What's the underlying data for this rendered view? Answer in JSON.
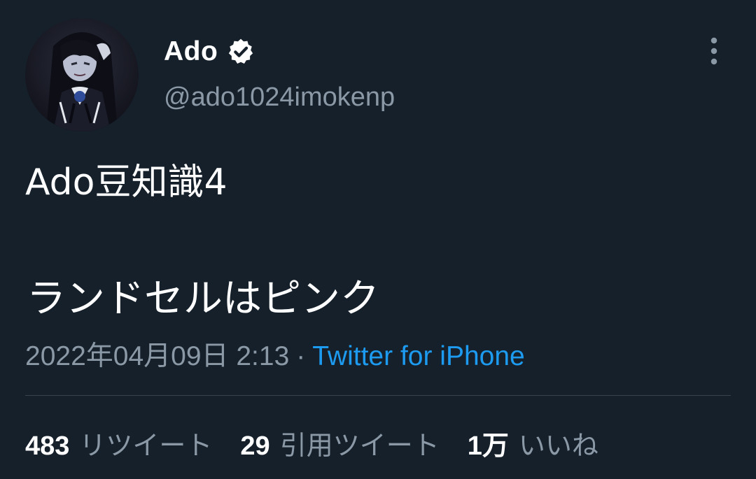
{
  "author": {
    "display_name": "Ado",
    "handle": "@ado1024imokenp",
    "verified": true
  },
  "tweet": {
    "text_line1": "Ado豆知識4",
    "text_line2": "ランドセルはピンク",
    "date": "2022年04月09日 2:13",
    "separator": "·",
    "source": "Twitter for iPhone"
  },
  "stats": {
    "retweets": {
      "count": "483",
      "label": "リツイート"
    },
    "quotes": {
      "count": "29",
      "label": "引用ツイート"
    },
    "likes": {
      "count": "1万",
      "label": "いいね"
    }
  },
  "icons": {
    "verified": "verified-badge-icon",
    "more": "more-vertical-icon"
  },
  "colors": {
    "background": "#15202b",
    "text": "#ffffff",
    "secondary": "#8b98a5",
    "link": "#1d9bf0",
    "divider": "#38444d"
  }
}
